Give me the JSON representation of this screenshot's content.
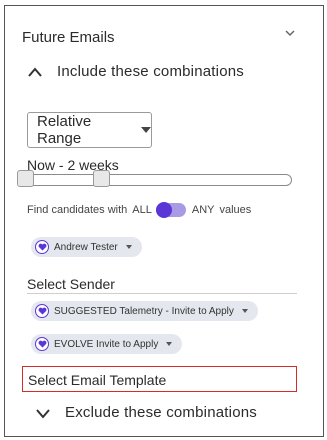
{
  "panel": {
    "title": "Future Emails",
    "collapse_icon": "chevron-down-icon"
  },
  "include": {
    "label": "Include these combinations",
    "icon": "chevron-up-icon"
  },
  "range": {
    "selected": "Relative Range",
    "value_label": "Now - 2 weeks",
    "slider": {
      "low_fraction": 0.0,
      "high_fraction": 0.29
    }
  },
  "match": {
    "prefix": "Find candidates with",
    "option_all": "ALL",
    "option_any": "ANY",
    "suffix": "values",
    "selected": "ALL"
  },
  "filters": {
    "candidate_chip": "Andrew Tester"
  },
  "sender": {
    "label": "Select Sender",
    "chips": [
      "SUGGESTED Talemetry - Invite to Apply",
      "EVOLVE Invite to Apply"
    ]
  },
  "template": {
    "placeholder": "Select Email Template"
  },
  "exclude": {
    "label": "Exclude these combinations",
    "icon": "chevron-down-icon"
  },
  "colors": {
    "accent": "#5a36d6",
    "toggle_track": "#a99ae6",
    "chip_bg": "#e4e7ed",
    "highlight_border": "#d52b2b"
  }
}
